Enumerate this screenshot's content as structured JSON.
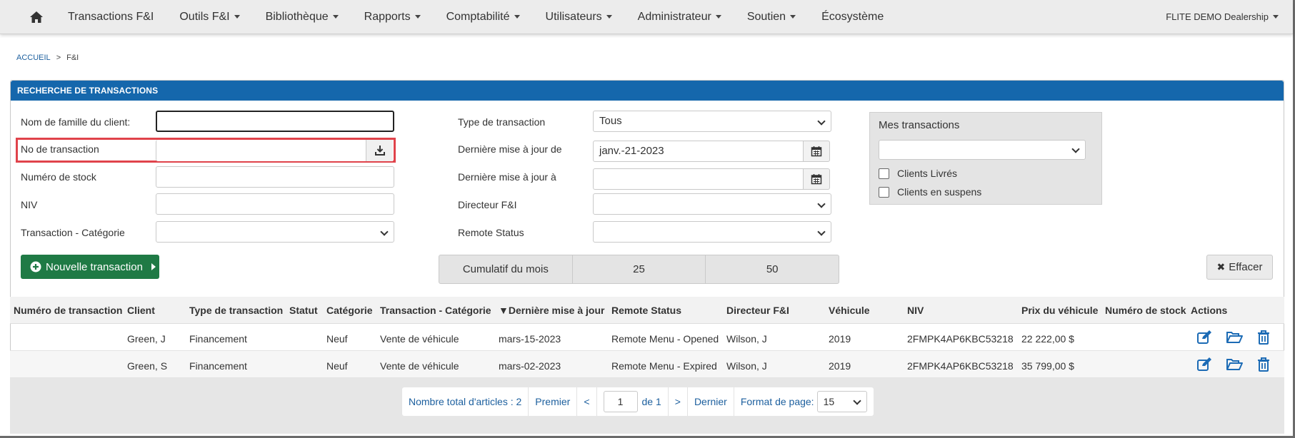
{
  "nav": {
    "items": [
      {
        "label": "Transactions F&I",
        "dropdown": false
      },
      {
        "label": "Outils F&I",
        "dropdown": true
      },
      {
        "label": "Bibliothèque",
        "dropdown": true
      },
      {
        "label": "Rapports",
        "dropdown": true
      },
      {
        "label": "Comptabilité",
        "dropdown": true
      },
      {
        "label": "Utilisateurs",
        "dropdown": true
      },
      {
        "label": "Administrateur",
        "dropdown": true
      },
      {
        "label": "Soutien",
        "dropdown": true
      },
      {
        "label": "Écosystème",
        "dropdown": false
      }
    ],
    "dealer": "FLITE DEMO Dealership"
  },
  "breadcrumb": {
    "home": "ACCUEIL",
    "sep": ">",
    "current": "F&I"
  },
  "panel": {
    "title": "RECHERCHE DE TRANSACTIONS"
  },
  "form": {
    "last_name_label": "Nom de famille du client:",
    "last_name_value": "",
    "deal_no_label": "No de transaction",
    "deal_no_value": "",
    "stock_label": "Numéro de stock",
    "stock_value": "",
    "vin_label": "NIV",
    "vin_value": "",
    "category_label": "Transaction - Catégorie",
    "category_value": "",
    "type_label": "Type de transaction",
    "type_value": "Tous",
    "updated_from_label": "Dernière mise à jour de",
    "updated_from_value": "janv.-21-2023",
    "updated_to_label": "Dernière mise à jour à",
    "updated_to_value": "",
    "manager_label": "Directeur F&I",
    "manager_value": "",
    "remote_label": "Remote Status",
    "remote_value": "",
    "my_deals_label": "Mes transactions",
    "my_deals_value": "",
    "chk_delivered": "Clients Livrés",
    "chk_pending": "Clients en suspens"
  },
  "buttons": {
    "new_deal": "Nouvelle transaction",
    "clear": "Effacer"
  },
  "cumulative": {
    "label": "Cumulatif du mois",
    "value1": "25",
    "value2": "50"
  },
  "table": {
    "headers": [
      "Numéro de transaction",
      "Client",
      "Type de transaction",
      "Statut",
      "Catégorie",
      "Transaction - Catégorie",
      "▼Dernière mise à jour",
      "Remote Status",
      "Directeur F&I",
      "Véhicule",
      "NIV",
      "Prix du véhicule",
      "Numéro de stock",
      "Actions"
    ],
    "rows": [
      {
        "deal_no": "",
        "client": "Green, J",
        "type": "Financement",
        "status": "",
        "category": "Neuf",
        "deal_category": "Vente de véhicule",
        "updated": "mars-15-2023",
        "remote": "Remote Menu - Opened",
        "manager": "Wilson, J",
        "vehicle": "2019",
        "vin": "2FMPK4AP6KBC53218",
        "price": "22 222,00 $",
        "stock": ""
      },
      {
        "deal_no": "",
        "client": "Green, S",
        "type": "Financement",
        "status": "",
        "category": "Neuf",
        "deal_category": "Vente de véhicule",
        "updated": "mars-02-2023",
        "remote": "Remote Menu - Expired",
        "manager": "Wilson, J",
        "vehicle": "2019",
        "vin": "2FMPK4AP6KBC53218",
        "price": "35 799,00 $",
        "stock": ""
      }
    ]
  },
  "pager": {
    "total": "Nombre total d'articles : 2",
    "first": "Premier",
    "prev": "<",
    "page": "1",
    "of": "de 1",
    "next": ">",
    "last": "Dernier",
    "size_label": "Format de page:",
    "size_value": "15"
  },
  "colors": {
    "header_blue": "#1567ac",
    "green": "#1f7a45",
    "highlight_red": "#e0434b",
    "link_blue": "#1c5f9e"
  }
}
